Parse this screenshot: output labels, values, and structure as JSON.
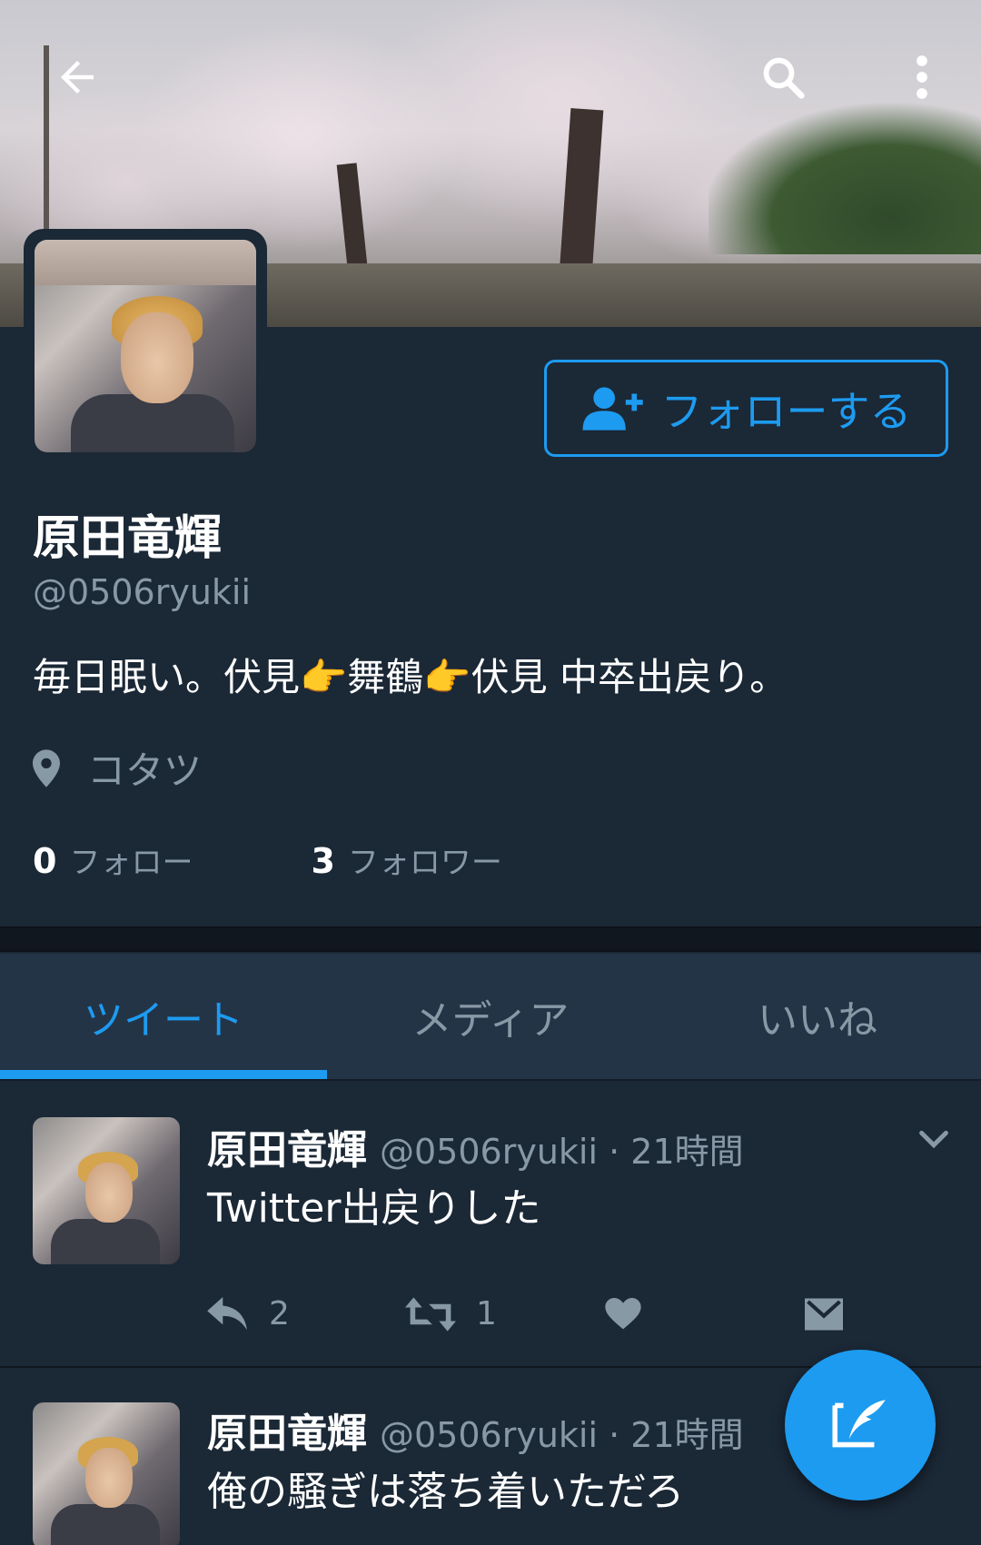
{
  "profile": {
    "name": "原田竜輝",
    "handle": "@0506ryukii",
    "bio": "毎日眠い。伏見👉舞鶴👉伏見 中卒出戻り。",
    "location": "コタツ",
    "following_count": "0",
    "following_label": "フォロー",
    "followers_count": "3",
    "followers_label": "フォロワー"
  },
  "follow_button": {
    "label": "フォローする"
  },
  "tabs": [
    {
      "label": "ツイート",
      "active": true
    },
    {
      "label": "メディア",
      "active": false
    },
    {
      "label": "いいね",
      "active": false
    }
  ],
  "tweets": [
    {
      "name": "原田竜輝",
      "meta": "@0506ryukii · 21時間",
      "text": "Twitter出戻りした",
      "replies": "2",
      "retweets": "1"
    },
    {
      "name": "原田竜輝",
      "meta": "@0506ryukii · 21時間",
      "text": "俺の騒ぎは落ち着いただろ"
    }
  ],
  "colors": {
    "accent": "#1d9bf0",
    "background": "#1b2836",
    "tab_bar": "#243447",
    "muted": "#8899a6"
  },
  "icons": [
    "back-arrow-icon",
    "search-icon",
    "more-vertical-icon",
    "add-user-icon",
    "location-pin-icon",
    "chevron-down-icon",
    "reply-icon",
    "retweet-icon",
    "heart-icon",
    "message-icon",
    "compose-icon"
  ]
}
